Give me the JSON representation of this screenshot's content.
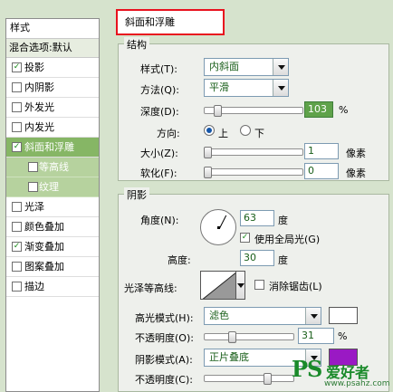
{
  "sidebar": {
    "header": "样式",
    "blend_options": "混合选项:默认",
    "items": [
      {
        "label": "投影",
        "checked": true
      },
      {
        "label": "内阴影",
        "checked": false
      },
      {
        "label": "外发光",
        "checked": false
      },
      {
        "label": "内发光",
        "checked": false
      },
      {
        "label": "斜面和浮雕",
        "checked": true
      },
      {
        "label": "等高线",
        "checked": false
      },
      {
        "label": "纹理",
        "checked": false
      },
      {
        "label": "光泽",
        "checked": false
      },
      {
        "label": "颜色叠加",
        "checked": false
      },
      {
        "label": "渐变叠加",
        "checked": true
      },
      {
        "label": "图案叠加",
        "checked": false
      },
      {
        "label": "描边",
        "checked": false
      }
    ]
  },
  "panel": {
    "title": "斜面和浮雕",
    "structure": {
      "title": "结构",
      "style_label": "样式(T):",
      "style_value": "内斜面",
      "technique_label": "方法(Q):",
      "technique_value": "平滑",
      "depth_label": "深度(D):",
      "depth_value": "103",
      "depth_unit": "%",
      "direction_label": "方向:",
      "direction_up": "上",
      "direction_down": "下",
      "size_label": "大小(Z):",
      "size_value": "1",
      "size_unit": "像素",
      "soften_label": "软化(F):",
      "soften_value": "0",
      "soften_unit": "像素"
    },
    "shading": {
      "title": "阴影",
      "angle_label": "角度(N):",
      "angle_value": "63",
      "angle_unit": "度",
      "global_light_label": "使用全局光(G)",
      "global_light_checked": true,
      "altitude_label": "高度:",
      "altitude_value": "30",
      "altitude_unit": "度",
      "gloss_contour_label": "光泽等高线:",
      "antialias_label": "消除锯齿(L)",
      "antialias_checked": false,
      "highlight_mode_label": "高光模式(H):",
      "highlight_mode_value": "滤色",
      "highlight_color": "#ffffff",
      "highlight_opacity_label": "不透明度(O):",
      "highlight_opacity_value": "31",
      "highlight_opacity_unit": "%",
      "shadow_mode_label": "阴影模式(A):",
      "shadow_mode_value": "正片叠底",
      "shadow_color": "#9a19c4",
      "shadow_opacity_label": "不透明度(C):"
    }
  },
  "watermark": {
    "brand": "PS",
    "name": "爱好者",
    "url": "www.psahz.com"
  }
}
